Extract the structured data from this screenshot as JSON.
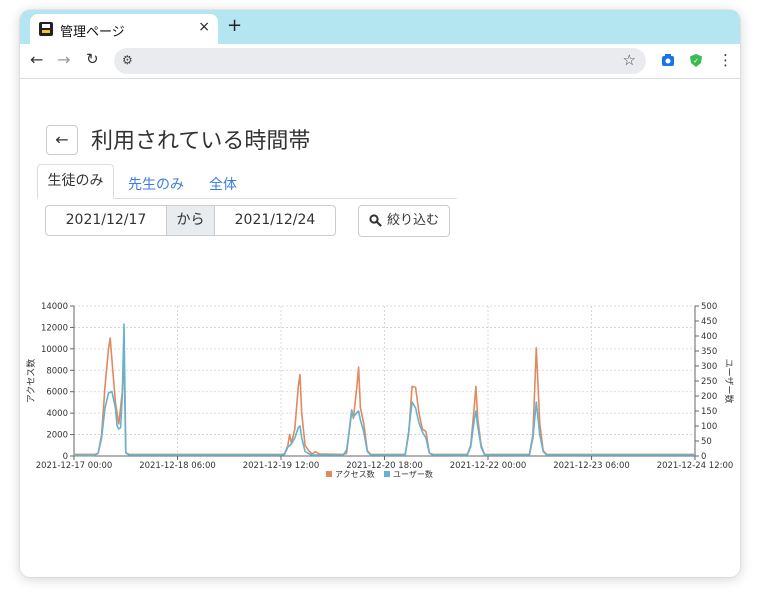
{
  "browser": {
    "tab_title": "管理ページ",
    "tab_close": "×",
    "new_tab": "+",
    "address": ""
  },
  "page": {
    "title": "利用されている時間帯",
    "back_icon": "←",
    "tabs": [
      {
        "label": "生徒のみ",
        "active": true
      },
      {
        "label": "先生のみ",
        "active": false
      },
      {
        "label": "全体",
        "active": false
      }
    ],
    "date_from": "2021/12/17",
    "date_connector": "から",
    "date_to": "2021/12/24",
    "filter_button": "絞り込む"
  },
  "chart_data": {
    "type": "line",
    "title": "",
    "ylabel": "アクセス数",
    "y2label": "ユーザー数",
    "ylim": [
      0,
      14000
    ],
    "y2lim": [
      0,
      500
    ],
    "y_ticks": [
      "0",
      "2000",
      "4000",
      "6000",
      "8000",
      "10000",
      "12000",
      "14000"
    ],
    "y2_ticks": [
      "0",
      "50",
      "100",
      "150",
      "200",
      "250",
      "300",
      "350",
      "400",
      "450",
      "500"
    ],
    "x_ticks": [
      "2021-12-17 00:00",
      "2021-12-18 06:00",
      "2021-12-19 12:00",
      "2021-12-20 18:00",
      "2021-12-22 00:00",
      "2021-12-23 06:00",
      "2021-12-24 12:00"
    ],
    "x_hours": [
      0,
      180
    ],
    "legend_position": "bottom",
    "grid": true,
    "series": [
      {
        "name": "アクセス数",
        "axis": "left",
        "color": "#e08a5f",
        "points": [
          [
            0,
            150
          ],
          [
            6,
            150
          ],
          [
            7,
            250
          ],
          [
            8,
            2000
          ],
          [
            9,
            6500
          ],
          [
            10,
            10000
          ],
          [
            10.5,
            11000
          ],
          [
            11,
            9000
          ],
          [
            12,
            5000
          ],
          [
            13,
            3000
          ],
          [
            14,
            6000
          ],
          [
            14.5,
            9000
          ],
          [
            15,
            300
          ],
          [
            16,
            150
          ],
          [
            60,
            150
          ],
          [
            61,
            200
          ],
          [
            62,
            1000
          ],
          [
            62.5,
            2000
          ],
          [
            63,
            1200
          ],
          [
            64,
            2500
          ],
          [
            65,
            6500
          ],
          [
            65.5,
            7600
          ],
          [
            66,
            4000
          ],
          [
            67,
            1000
          ],
          [
            68,
            500
          ],
          [
            69,
            200
          ],
          [
            70,
            400
          ],
          [
            71,
            200
          ],
          [
            78,
            150
          ],
          [
            79,
            250
          ],
          [
            80,
            3000
          ],
          [
            80.5,
            4300
          ],
          [
            81,
            3500
          ],
          [
            82,
            6500
          ],
          [
            82.5,
            8300
          ],
          [
            83,
            4500
          ],
          [
            84,
            3000
          ],
          [
            85,
            500
          ],
          [
            86,
            150
          ],
          [
            96,
            150
          ],
          [
            97,
            2000
          ],
          [
            98,
            6500
          ],
          [
            99,
            6400
          ],
          [
            100,
            4000
          ],
          [
            101,
            2500
          ],
          [
            102,
            2300
          ],
          [
            103,
            300
          ],
          [
            104,
            150
          ],
          [
            114,
            150
          ],
          [
            115,
            1000
          ],
          [
            116,
            4500
          ],
          [
            116.5,
            6500
          ],
          [
            117,
            3500
          ],
          [
            118,
            1000
          ],
          [
            119,
            150
          ],
          [
            132,
            150
          ],
          [
            133,
            2000
          ],
          [
            134,
            10100
          ],
          [
            135,
            3000
          ],
          [
            136,
            500
          ],
          [
            137,
            150
          ],
          [
            180,
            150
          ]
        ]
      },
      {
        "name": "ユーザー数",
        "axis": "right",
        "color": "#63b3d1",
        "points": [
          [
            0,
            2
          ],
          [
            6,
            2
          ],
          [
            7,
            10
          ],
          [
            8,
            60
          ],
          [
            9,
            160
          ],
          [
            10,
            210
          ],
          [
            11,
            215
          ],
          [
            12,
            160
          ],
          [
            12.5,
            100
          ],
          [
            13,
            90
          ],
          [
            13.5,
            95
          ],
          [
            14,
            200
          ],
          [
            14.5,
            440
          ],
          [
            15,
            10
          ],
          [
            16,
            3
          ],
          [
            60,
            3
          ],
          [
            61,
            5
          ],
          [
            62,
            30
          ],
          [
            63,
            40
          ],
          [
            64,
            60
          ],
          [
            65,
            95
          ],
          [
            65.5,
            100
          ],
          [
            66,
            60
          ],
          [
            67,
            15
          ],
          [
            68,
            8
          ],
          [
            69,
            3
          ],
          [
            78,
            3
          ],
          [
            79,
            20
          ],
          [
            80,
            100
          ],
          [
            80.5,
            150
          ],
          [
            81,
            130
          ],
          [
            82,
            145
          ],
          [
            82.5,
            150
          ],
          [
            83,
            120
          ],
          [
            84,
            80
          ],
          [
            85,
            15
          ],
          [
            86,
            3
          ],
          [
            96,
            3
          ],
          [
            97,
            80
          ],
          [
            98,
            180
          ],
          [
            99,
            160
          ],
          [
            100,
            110
          ],
          [
            101,
            80
          ],
          [
            102,
            60
          ],
          [
            103,
            10
          ],
          [
            104,
            3
          ],
          [
            114,
            3
          ],
          [
            115,
            30
          ],
          [
            116,
            120
          ],
          [
            116.5,
            150
          ],
          [
            117,
            100
          ],
          [
            118,
            30
          ],
          [
            119,
            3
          ],
          [
            132,
            3
          ],
          [
            133,
            60
          ],
          [
            134,
            180
          ],
          [
            135,
            70
          ],
          [
            136,
            15
          ],
          [
            137,
            3
          ],
          [
            180,
            3
          ]
        ]
      }
    ]
  }
}
